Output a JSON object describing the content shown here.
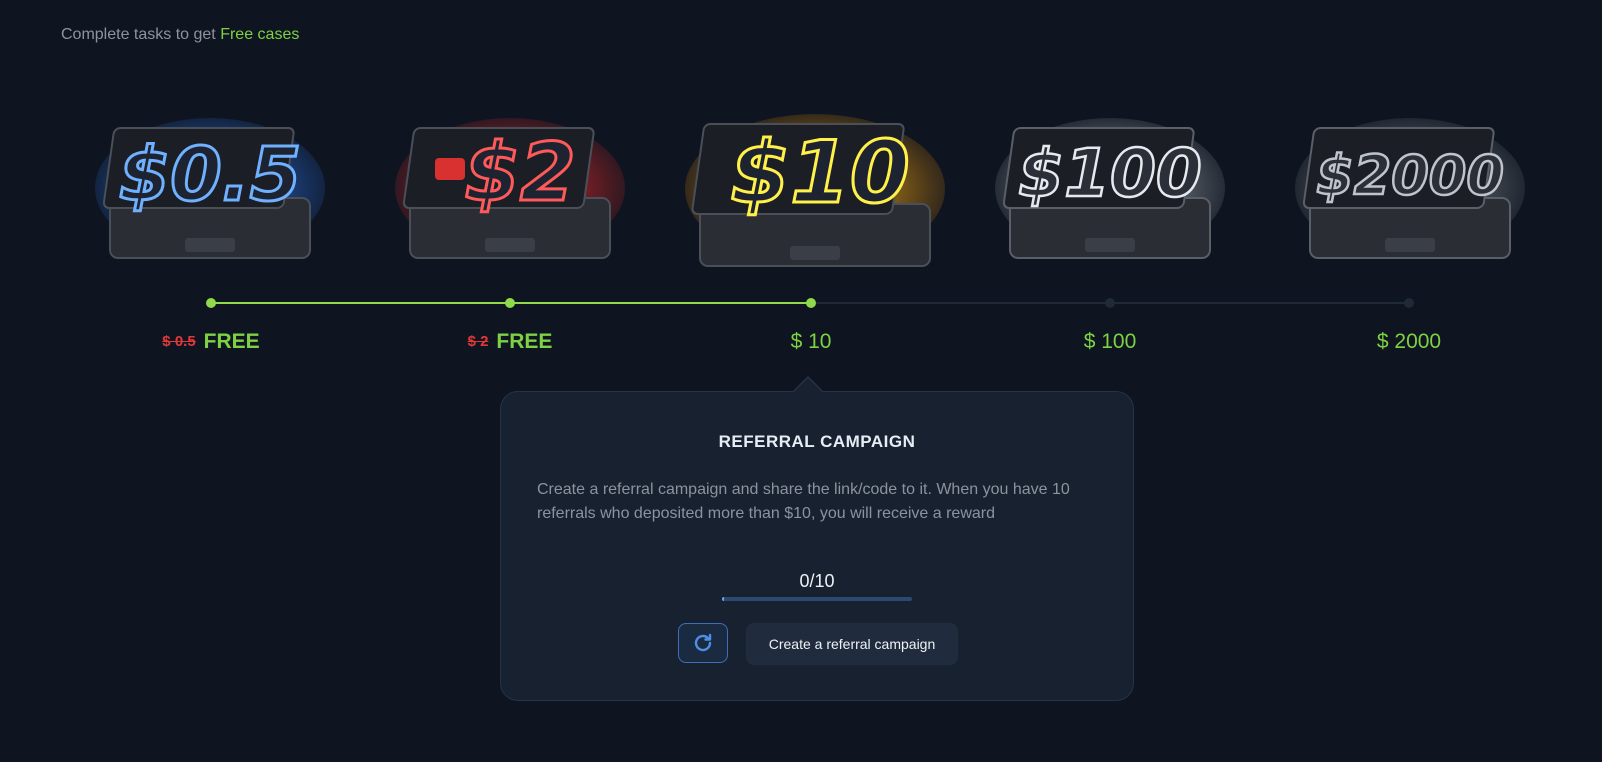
{
  "intro": {
    "prefix": "Complete tasks to get",
    "highlight": "Free cases"
  },
  "cases": [
    {
      "label": "$0.5",
      "theme": "blue",
      "old_price": "$ 0.5",
      "price": "FREE",
      "state": "done"
    },
    {
      "label": "$2",
      "theme": "red",
      "old_price": "$ 2",
      "price": "FREE",
      "state": "done"
    },
    {
      "label": "$10",
      "theme": "gold",
      "old_price": "",
      "price": "$ 10",
      "state": "current"
    },
    {
      "label": "$100",
      "theme": "silver",
      "old_price": "",
      "price": "$ 100",
      "state": "locked"
    },
    {
      "label": "$2000",
      "theme": "silver",
      "old_price": "",
      "price": "$ 2000",
      "state": "locked"
    }
  ],
  "panel": {
    "title": "REFERRAL CAMPAIGN",
    "description": "Create a referral campaign and share the link/code to it. When you have 10 referrals who deposited more than $10, you will receive a reward",
    "progress_text": "0/10",
    "progress_fraction": 0,
    "create_label": "Create a referral campaign",
    "refresh_icon": "refresh-icon"
  },
  "colors": {
    "accent_green": "#7dd142",
    "strike_red": "#e03838",
    "button_blue": "#3d6fb6"
  }
}
